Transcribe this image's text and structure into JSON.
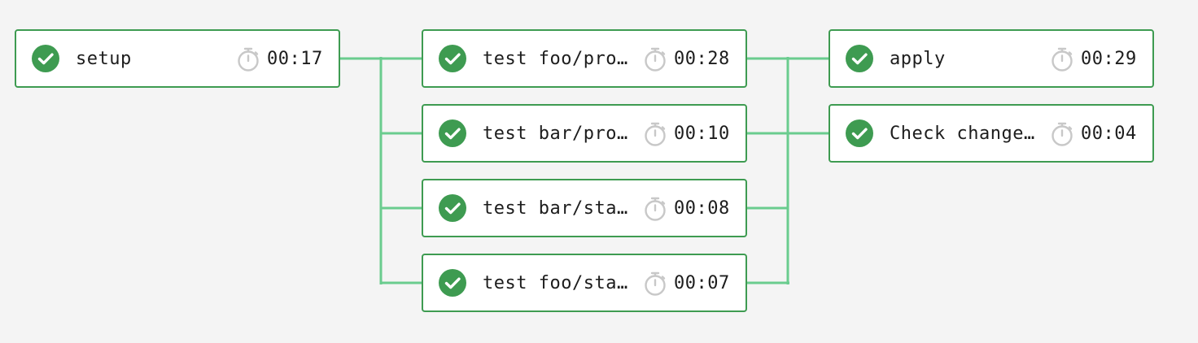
{
  "colors": {
    "background": "#f4f4f4",
    "card_border": "#3e9b51",
    "success": "#3e9b51",
    "connector": "#6acc8e",
    "timer_icon": "#c8c8c8",
    "text": "#1d1d1d"
  },
  "stages": [
    {
      "jobs": [
        {
          "name": "setup",
          "status": "success",
          "status_icon": "check-circle-icon",
          "duration": "00:17"
        }
      ]
    },
    {
      "jobs": [
        {
          "name": "test foo/pro…",
          "status": "success",
          "status_icon": "check-circle-icon",
          "duration": "00:28"
        },
        {
          "name": "test bar/pro…",
          "status": "success",
          "status_icon": "check-circle-icon",
          "duration": "00:10"
        },
        {
          "name": "test bar/sta…",
          "status": "success",
          "status_icon": "check-circle-icon",
          "duration": "00:08"
        },
        {
          "name": "test foo/sta…",
          "status": "success",
          "status_icon": "check-circle-icon",
          "duration": "00:07"
        }
      ]
    },
    {
      "jobs": [
        {
          "name": "apply",
          "status": "success",
          "status_icon": "check-circle-icon",
          "duration": "00:29"
        },
        {
          "name": "Check change…",
          "status": "success",
          "status_icon": "check-circle-icon",
          "duration": "00:04"
        }
      ]
    }
  ],
  "timer_icon": "stopwatch-icon"
}
